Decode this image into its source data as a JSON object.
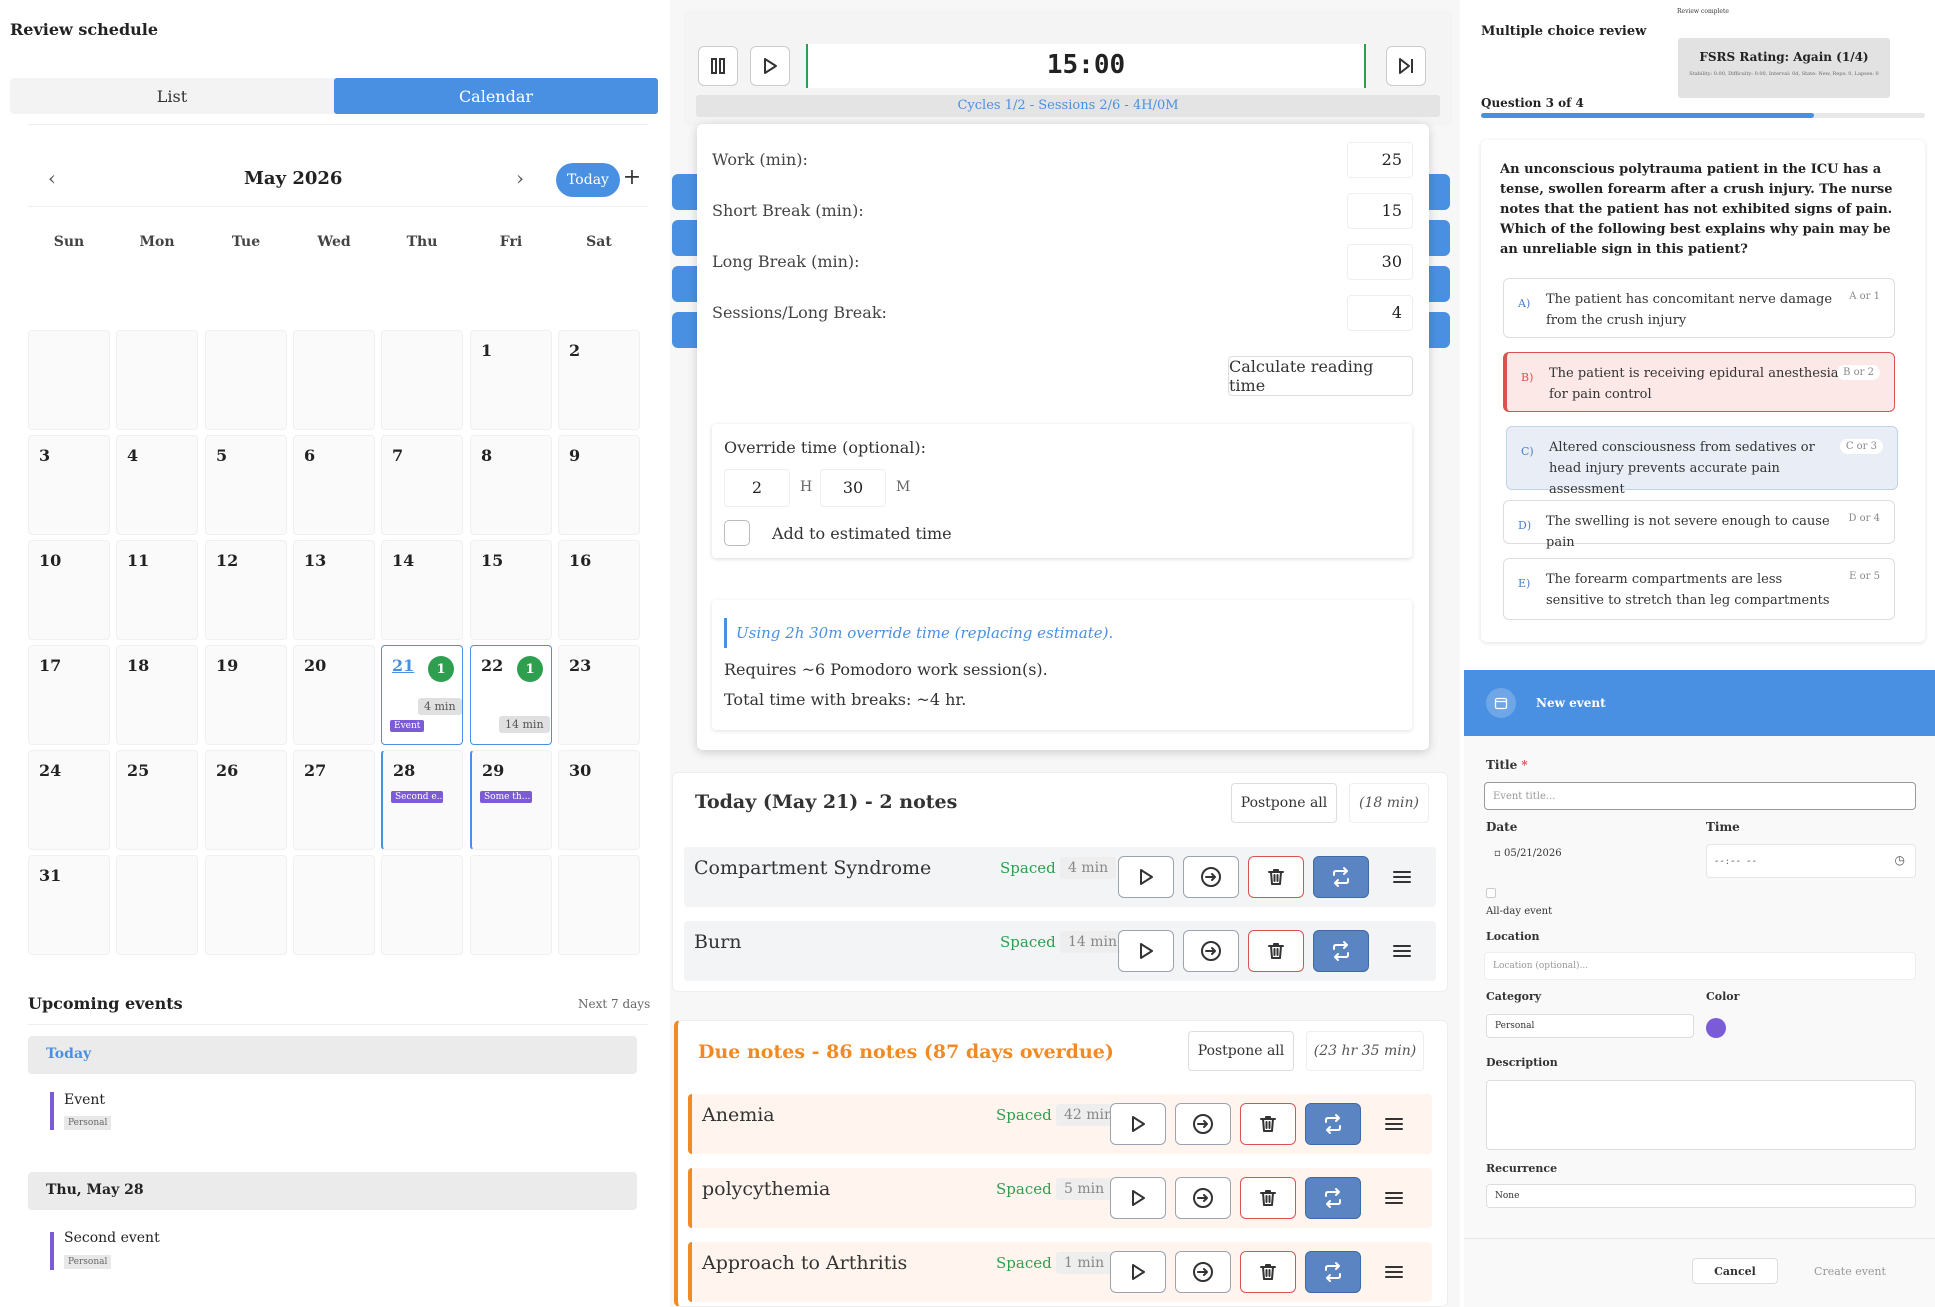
{
  "left": {
    "title": "Review schedule",
    "tabs": [
      {
        "label": "List"
      },
      {
        "label": "Calendar"
      }
    ],
    "month_label": "May 2026",
    "today_btn": "Today",
    "plus": "+",
    "weekdays": [
      "Sun",
      "Mon",
      "Tue",
      "Wed",
      "Thu",
      "Fri",
      "Sat"
    ],
    "days": [
      "1",
      "2",
      "3",
      "4",
      "5",
      "6",
      "7",
      "8",
      "9",
      "10",
      "11",
      "12",
      "13",
      "14",
      "15",
      "16",
      "17",
      "18",
      "19",
      "20",
      "21",
      "22",
      "23",
      "24",
      "25",
      "26",
      "27",
      "28",
      "29",
      "30",
      "31"
    ],
    "day21": {
      "badge": "1",
      "min": "4 min",
      "event": "Event"
    },
    "day22": {
      "badge": "1",
      "min": "14 min"
    },
    "day28": {
      "event": "Second e..."
    },
    "day29": {
      "event": "Some th..."
    },
    "upcoming": {
      "title": "Upcoming events",
      "range": "Next 7 days",
      "groups": [
        {
          "header": "Today",
          "event": "Event",
          "cat": "Personal"
        },
        {
          "header": "Thu, May 28",
          "event": "Second event",
          "cat": "Personal"
        }
      ]
    }
  },
  "timer": {
    "time": "15:00",
    "cycles": "Cycles 1/2 - Sessions 2/6 - 4H/0M"
  },
  "settings": {
    "work_label": "Work (min):",
    "work_val": "25",
    "short_label": "Short Break (min):",
    "short_val": "15",
    "long_label": "Long Break (min):",
    "long_val": "30",
    "sessions_label": "Sessions/Long Break:",
    "sessions_val": "4",
    "calc_btn": "Calculate reading time",
    "override_label": "Override time (optional):",
    "hours": "2",
    "h": "H",
    "minutes": "30",
    "m": "M",
    "add_label": "Add to estimated time",
    "info_italic": "Using 2h 30m override time (replacing estimate).",
    "info_requires": "Requires ~6 Pomodoro work session(s).",
    "info_total": "Total time with breaks: ~4 hr."
  },
  "today_notes": {
    "title": "Today (May 21) - 2 notes",
    "postpone": "Postpone all",
    "total": "(18 min)",
    "notes": [
      {
        "name": "Compartment Syndrome",
        "tag": "Spaced",
        "min": "4 min"
      },
      {
        "name": "Burn",
        "tag": "Spaced",
        "min": "14 min"
      }
    ]
  },
  "due_notes": {
    "title": "Due notes - 86 notes (87 days overdue)",
    "postpone": "Postpone all",
    "total": "(23 hr 35 min)",
    "notes": [
      {
        "name": "Anemia",
        "tag": "Spaced",
        "min": "42 min"
      },
      {
        "name": "polycythemia",
        "tag": "Spaced",
        "min": "5 min"
      },
      {
        "name": "Approach to Arthritis",
        "tag": "Spaced",
        "min": "1 min"
      }
    ]
  },
  "mcq": {
    "title": "Multiple choice review",
    "review_complete": "Review complete",
    "fsrs_title": "FSRS Rating: Again (1/4)",
    "fsrs_sub": "Stability: 0.00, Difficulty: 0.00, Interval: 0d, State: New, Reps: 0, Lapses: 0",
    "progress_label": "Question 3 of 4",
    "progress_fraction": 0.75,
    "question": "An unconscious polytrauma patient in the ICU has a tense, swollen forearm after a crush injury. The nurse notes that the patient has not exhibited signs of pain. Which of the following best explains why pain may be an unreliable sign in this patient?",
    "options": [
      {
        "letter": "A)",
        "text": "The patient has concomitant nerve damage from the crush injury",
        "key": "A or 1"
      },
      {
        "letter": "B)",
        "text": "The patient is receiving epidural anesthesia for pain control",
        "key": "B or 2"
      },
      {
        "letter": "C)",
        "text": "Altered consciousness from sedatives or head injury prevents accurate pain assessment",
        "key": "C or 3"
      },
      {
        "letter": "D)",
        "text": "The swelling is not severe enough to cause pain",
        "key": "D or 4"
      },
      {
        "letter": "E)",
        "text": "The forearm compartments are less sensitive to stretch than leg compartments",
        "key": "E or 5"
      }
    ]
  },
  "new_event": {
    "header": "New event",
    "title_label": "Title",
    "required": "*",
    "title_placeholder": "Event title...",
    "date_label": "Date",
    "date_value": "05/21/2026",
    "time_label": "Time",
    "time_value": "--:-- --",
    "allday": "All-day event",
    "location_label": "Location",
    "location_placeholder": "Location (optional)...",
    "category_label": "Category",
    "category_value": "Personal",
    "color_label": "Color",
    "color": "#7b5cd6",
    "description_label": "Description",
    "recurrence_label": "Recurrence",
    "recurrence_value": "None",
    "cancel": "Cancel",
    "create": "Create event"
  },
  "colors": {
    "accent": "#4a90e2",
    "green": "#2e9e4f",
    "orange": "#f08a24",
    "purple": "#7b5cd6",
    "red": "#d9534f"
  }
}
